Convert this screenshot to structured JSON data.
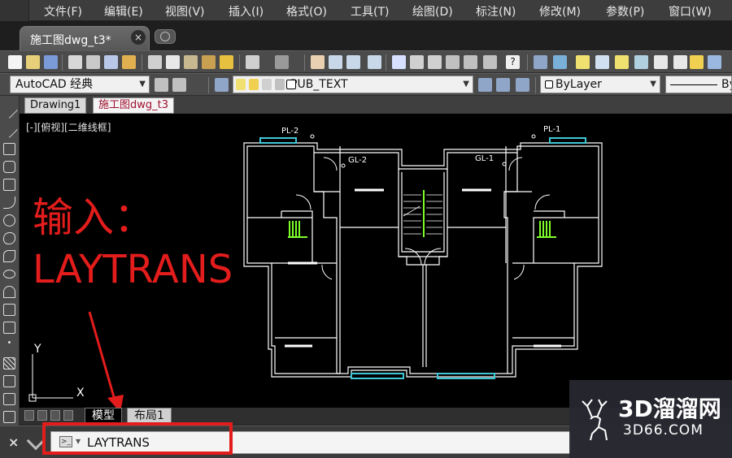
{
  "menu": [
    "文件(F)",
    "编辑(E)",
    "视图(V)",
    "插入(I)",
    "格式(O)",
    "工具(T)",
    "绘图(D)",
    "标注(N)",
    "修改(M)",
    "参数(P)",
    "窗口(W)"
  ],
  "document_tab": {
    "label": "施工图dwg_t3*",
    "close": "×"
  },
  "toolbar": {
    "workspace": "AutoCAD 经典",
    "layer": "PUB_TEXT",
    "color": "ByLayer",
    "linetype": "By"
  },
  "drawing_tabs": [
    "Drawing1",
    "施工图dwg_t3"
  ],
  "canvas": {
    "view_label": "[-][俯视][二维线框]",
    "labels": {
      "pl2": "PL-2",
      "pl1": "PL-1",
      "gl2": "GL-2",
      "gl1": "GL-1",
      "axis_x": "X",
      "axis_y": "Y"
    }
  },
  "annotation": {
    "line1": "输入：",
    "line2": "LAYTRANS"
  },
  "layout_tabs": [
    "模型",
    "布局1"
  ],
  "command": {
    "close": "×",
    "prompt_icon": ">_",
    "text": "LAYTRANS"
  },
  "watermark": {
    "brand": "3D溜溜网",
    "url": "3D66.COM"
  },
  "colors": {
    "annotation": "#e31c1c",
    "plan_lines": "#ffffff",
    "window_cyan": "#3fc6d6",
    "stair_green": "#7fff2a"
  }
}
